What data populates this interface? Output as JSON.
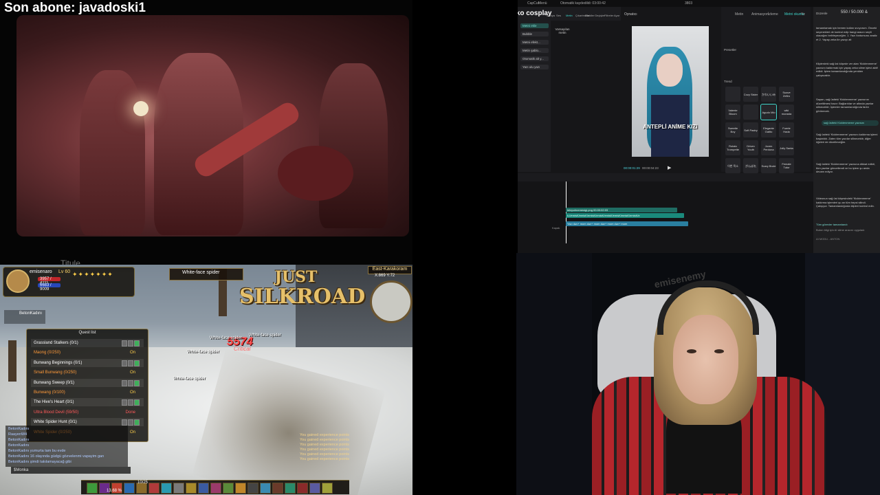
{
  "overlay": {
    "subscriber_banner": "Son abone: javadoski1"
  },
  "video": {
    "caption": "Titule"
  },
  "game": {
    "character": {
      "name": "emisenaro",
      "level": "Lv 60",
      "hp": "3957 / 4111",
      "mp": "6683 / 9009"
    },
    "target": {
      "name": "White-face spider"
    },
    "party": {
      "member": "BetonKadını"
    },
    "logo": {
      "line1": "JUST",
      "line2": "SILKROAD"
    },
    "zone": {
      "name": "East-Karakoram",
      "coords": "X:869   Y:72"
    },
    "damage": {
      "value": "5574",
      "label": "Critical"
    },
    "mob_labels": [
      "White-face spider",
      "White-face spider",
      "White-face spider",
      "White-face spider"
    ],
    "quest_list": {
      "title": "Quest list",
      "items": [
        {
          "name": "Grassland Stalkers (0/1)",
          "status": "",
          "color": "#ffffff"
        },
        {
          "name": "Maong (0/250)",
          "status": "On",
          "color": "#ff9a3a"
        },
        {
          "name": "Bunwang Beginnings (0/1)",
          "status": "",
          "color": "#ffffff"
        },
        {
          "name": "Small Bunwang (0/250)",
          "status": "On",
          "color": "#ff9a3a"
        },
        {
          "name": "Bunwang Sweep (0/1)",
          "status": "",
          "color": "#ffffff"
        },
        {
          "name": "Bunwang (0/100)",
          "status": "On",
          "color": "#ff9a3a"
        },
        {
          "name": "The Hive's Heart (0/1)",
          "status": "",
          "color": "#ffffff"
        },
        {
          "name": "Ultra Blood Devil (59/50)",
          "status": "Done",
          "color": "#ff5a5a"
        },
        {
          "name": "White Spider Hunt (0/1)",
          "status": "",
          "color": "#ffffff"
        },
        {
          "name": "White Spider (0/250)",
          "status": "On",
          "color": "#ff9a3a"
        }
      ]
    },
    "chat": {
      "lines": [
        "BetonKadını",
        "RaayenW4",
        "BetonKadını",
        "BetonKadını",
        "BetonKadını yumurta tam bu evde",
        "BetonKadını 16 olayında güdgü gözvelenmi vapayim gan",
        "BetonKadını şimdi takılamayacağ gibi"
      ],
      "input": "$Monka"
    },
    "exp_log": [
      "You gained experience points",
      "You gained experience points",
      "You gained experience points",
      "You gained experience points",
      "You gained experience points",
      "You gained experience points"
    ],
    "exp_pct": "13.68 %",
    "exp_level": "10/25"
  },
  "editor": {
    "topbar": [
      "CapCut",
      "Menü",
      "Otomatik kaydedildi: 03:00:42",
      "3803"
    ],
    "toolbar_items": [
      "Medya",
      "Ses",
      "Metin",
      "Çıkartmalar",
      "Efektler",
      "Geçişler",
      "Filtreler",
      "Ayar"
    ],
    "watermark": "nezuko cosplay",
    "left_items": [
      "Metni ekle",
      "Bubble",
      "Metni efekt...",
      "Metin şablo...",
      "Otomatik alt y...",
      "Yazı ulu yazı"
    ],
    "import_label": "Varsayılan metin",
    "player_header": "Oynatıcı",
    "player_caption": "ANTEPLİ ANİME KIZI",
    "time_current": "00:00:01:29",
    "time_total": "00:00:04:23",
    "props_tabs": [
      "Metin",
      "Animasyon",
      "İzleme",
      "Metni okuma",
      "Yz"
    ],
    "presets_label": "Presetler",
    "trendy_label": "Trend",
    "styles": [
      "",
      "Cozy Sister",
      "かわいいみ",
      "Suave Zefiro",
      "Valente Bloom",
      "",
      "Agudo Mio",
      "wiki morasta",
      "Sweetie Boy",
      "Soft Pastry",
      "Elegante Gatito",
      "Fuerte Hada",
      "Rotato Trompette",
      "Driven Youth",
      "Joven Perdona",
      "Jolly Santa",
      "이번 목소",
      "がんばれ ",
      "Scary Brute",
      "Female Tutor"
    ],
    "chat": {
      "counter": "550 / 50.000 &",
      "edit_label": "Düzenle",
      "para1": "tamamlamak için hemen kolları sıvıyorum. Önceki seçenekleri de kontrol edip hangi aracın seçili olacağını belirleyeceğim. 1. Yazı fontumunu analiz et 2. Yapay zeka ile yazıyı ait",
      "para2": "Kliplerdeki sağ üst köşede ver alan 'Kicktenmeme' yazısını kaldırmak için yapay zeka silme işlevi aktif edildi. İşlem tamamlandığında yeniden çalışacaktır.",
      "para3": "Sapan, sağ üstteki 'Kicktenmeme' yazısının düzeltilmesi hazır: Bağlantılar ve altında yazılar silinecektir; İşlemler tamamlandığında farklı görünecek.",
      "highlight": "sağ üstteki Kicktenmeme yazısını",
      "para4": "Sağ üstteki 'Kicktenmeme' yazısını kaldırma işlemi başlatıldı. Zaten tüm yazılar silinecektir, diğer öğeleri de düzelteceğim.",
      "para5": "Sağ üstteki 'Kicktenmeme' yazısına dikkat edildi, tüm yazılar güncellendi ve bu işlem şu anda devam ediyor.",
      "para6": "Videonun sağ üst köşesindeki 'Kicktenmeme' kaldırma işlemleri şu an tüm hepsi silindi. Çalışıyor. Tamamlandığında klipleri kontrol edin.",
      "task_done": "Tüm görevler tamamlandı",
      "task_sub": "Buton bilgi için AI silme aracını uyguladı",
      "footer": "AI MODU - ANTON"
    },
    "timeline": {
      "track1": "telepuhnemesigi.png  00:00:02:03",
      "track2": "k-t/emisK/emisK/emisK/emisK/emisK/emisK/emisK/emisK/e",
      "track3": "Yazı  dəv+ mom  dəv+ mom  dəv+ mom  dəv+ mom",
      "cover_label": "Kapak"
    }
  },
  "webcam": {
    "chair_brand": "emisenemy"
  }
}
